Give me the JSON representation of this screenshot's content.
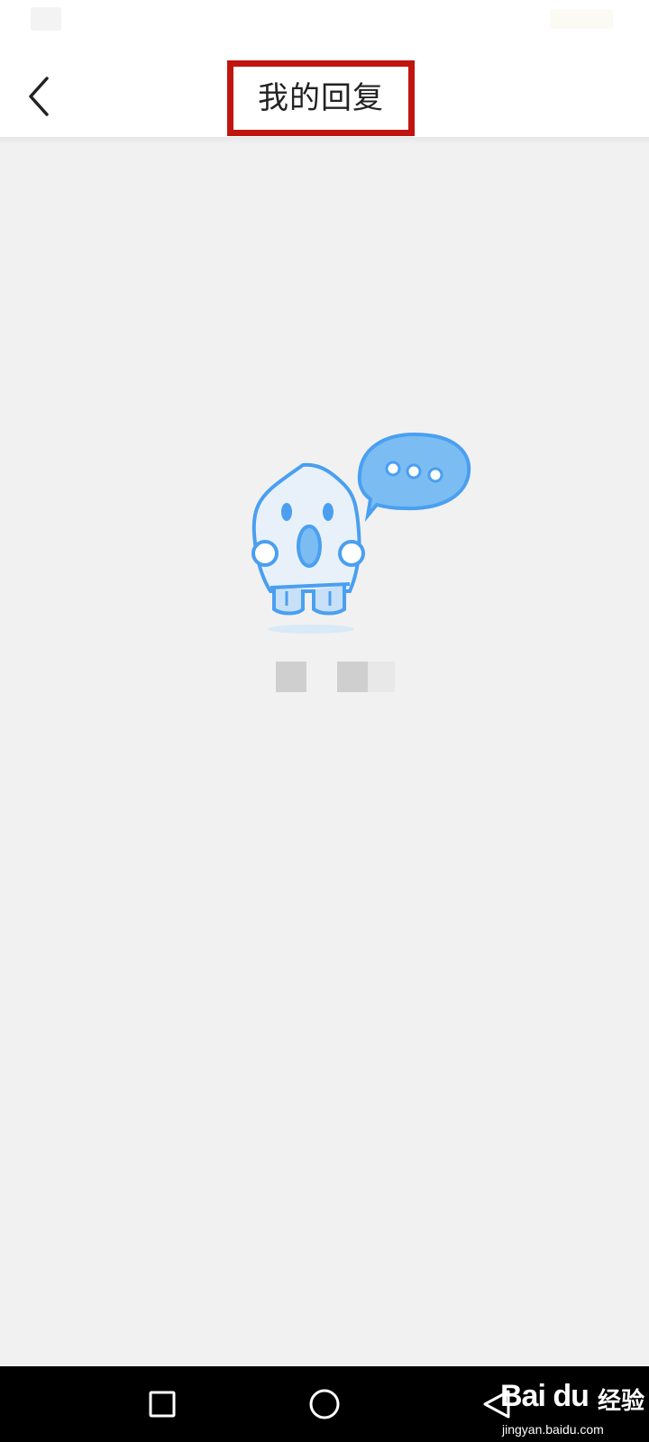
{
  "header": {
    "title": "我的回复"
  },
  "icons": {
    "back": "chevron-left-icon",
    "empty_state": "ghost-mascot-with-speech-bubble",
    "nav_recent": "square-icon",
    "nav_home": "circle-icon",
    "nav_back": "triangle-back-icon"
  },
  "colors": {
    "highlight_border": "#c0150f",
    "mascot_blue": "#4a9ff0",
    "background": "#f1f1f1",
    "nav_bar": "#000000"
  },
  "watermark": {
    "brand": "Bai du",
    "product": "经验",
    "domain": "jingyan.baidu.com"
  }
}
